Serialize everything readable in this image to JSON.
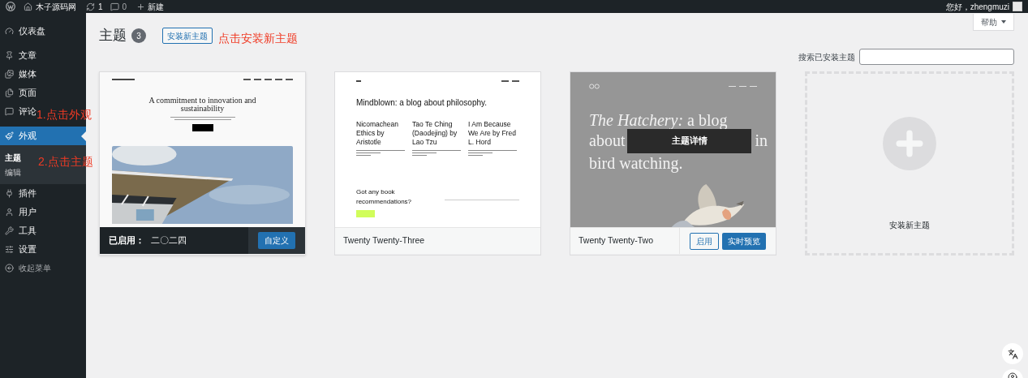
{
  "admin_bar": {
    "site_name": "木子源码网",
    "updates": "1",
    "comments": "0",
    "new_label": "新建",
    "greeting": "您好，zhengmuzi"
  },
  "sidebar": {
    "items": [
      {
        "label": "仪表盘",
        "selected": false
      },
      {
        "label": "文章",
        "selected": false
      },
      {
        "label": "媒体",
        "selected": false
      },
      {
        "label": "页面",
        "selected": false
      },
      {
        "label": "评论",
        "selected": false
      },
      {
        "label": "外观",
        "selected": true,
        "children": [
          {
            "label": "主题",
            "selected": true
          },
          {
            "label": "编辑",
            "selected": false
          }
        ]
      },
      {
        "label": "插件",
        "selected": false
      },
      {
        "label": "用户",
        "selected": false
      },
      {
        "label": "工具",
        "selected": false
      },
      {
        "label": "设置",
        "selected": false
      }
    ],
    "collapse": "收起菜单"
  },
  "help_button": "帮助",
  "header": {
    "title": "主题",
    "count": "3",
    "add_button": "安装新主题"
  },
  "search": {
    "label": "搜索已安装主题"
  },
  "themes": [
    {
      "kind": "active",
      "status": "已启用：",
      "name": "二〇二四",
      "buttons": [
        "自定义"
      ],
      "preview": {
        "kind": "architecture",
        "heading": "A commitment to innovation and sustainability"
      }
    },
    {
      "kind": "inactive",
      "name": "Twenty Twenty-Three",
      "preview": {
        "kind": "philosophy",
        "heading": "Mindblown: a blog about philosophy.",
        "posts": [
          "Nicomachean Ethics by Aristotle",
          "Tao Te Ching (Daodejing) by Lao Tzu",
          "I Am Because We Are by Fred L. Hord"
        ],
        "cta": "Got any book recommendations?"
      }
    },
    {
      "kind": "hover",
      "name": "Twenty Twenty-Two",
      "buttons": [
        "启用",
        "实时预览"
      ],
      "overlay": "主题详情",
      "preview": {
        "kind": "birds",
        "line_1": "*The Hatchery:* a blog",
        "line_2_start": "about",
        "line_2_end": "in",
        "line_3": "bird watching."
      }
    },
    {
      "kind": "add",
      "name": "安装新主题"
    }
  ],
  "annotations": [
    "点击安装新主题",
    "1.点击外观",
    "2.点击主题"
  ]
}
